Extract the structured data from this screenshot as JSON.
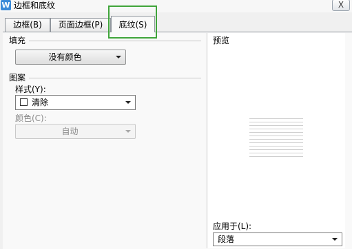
{
  "window": {
    "title": "边框和底纹",
    "app_icon": "W",
    "close_label": "X"
  },
  "tabs": [
    {
      "label": "边框(B)",
      "active": false
    },
    {
      "label": "页面边框(P)",
      "active": false
    },
    {
      "label": "底纹(S)",
      "active": true
    }
  ],
  "highlight_color": "#3fa43a",
  "fill": {
    "section_label": "填充",
    "value": "没有颜色"
  },
  "pattern": {
    "section_label": "图案",
    "style_label": "样式(Y):",
    "style_value": "清除",
    "color_label": "颜色(C):",
    "color_value": "自动"
  },
  "preview": {
    "label": "预览"
  },
  "apply_to": {
    "label": "应用于(L):",
    "value": "段落"
  }
}
